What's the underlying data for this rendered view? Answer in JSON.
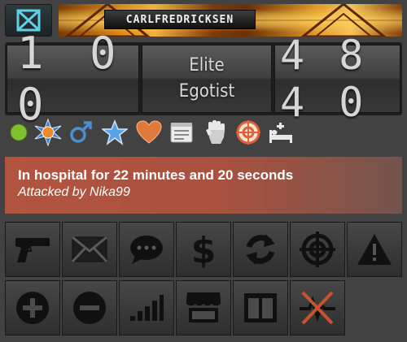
{
  "profile": {
    "name": "CARLFREDRICKSEN",
    "level": "1 0 0",
    "rank_line1": "Elite",
    "rank_line2": "Egotist",
    "age": "4 8 4 0"
  },
  "status_icons": [
    {
      "name": "online-status-icon",
      "color": "#7ec02f"
    },
    {
      "name": "donator-star-icon",
      "color": "#e8a838"
    },
    {
      "name": "male-gender-icon",
      "color": "#4a8fd0"
    },
    {
      "name": "subscriber-star-icon",
      "color": "#4a8fd0"
    },
    {
      "name": "married-heart-icon",
      "color": "#e07a3a"
    },
    {
      "name": "job-notes-icon",
      "color": "#e8e8e8"
    },
    {
      "name": "faction-fist-icon",
      "color": "#e8e8e8"
    },
    {
      "name": "bounty-target-icon",
      "color": "#e0603a"
    },
    {
      "name": "hospital-bed-icon",
      "color": "#e8e8e8"
    }
  ],
  "hospital": {
    "title": "In hospital for 22 minutes and 20 seconds",
    "subtitle": "Attacked by Nika99",
    "color": "#b2553f"
  },
  "actions": [
    {
      "name": "attack-gun-icon"
    },
    {
      "name": "send-message-icon"
    },
    {
      "name": "chat-bubble-icon"
    },
    {
      "name": "send-money-icon"
    },
    {
      "name": "trade-arrows-icon"
    },
    {
      "name": "place-bounty-icon"
    },
    {
      "name": "report-warning-icon"
    },
    {
      "name": "add-friend-icon"
    },
    {
      "name": "add-enemy-icon"
    },
    {
      "name": "stats-chart-icon"
    },
    {
      "name": "bazaar-shop-icon"
    },
    {
      "name": "display-case-icon"
    },
    {
      "name": "revive-disabled-icon"
    }
  ]
}
